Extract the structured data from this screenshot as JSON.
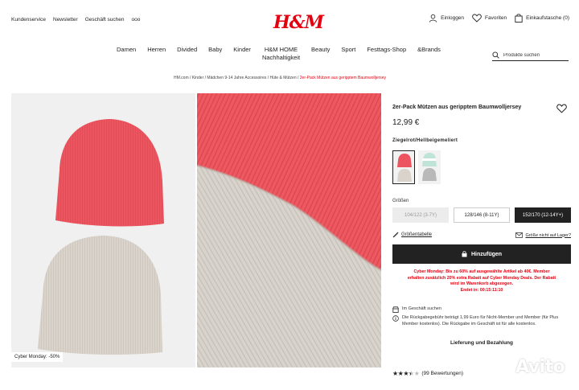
{
  "header": {
    "util_links": [
      "Kundenservice",
      "Newsletter",
      "Geschäft suchen",
      "ooo"
    ],
    "logo": "H&M",
    "account": {
      "login": "Einloggen",
      "favorites": "Favoriten",
      "cart": "Einkaufstasche (0)"
    }
  },
  "nav": {
    "items": [
      "Damen",
      "Herren",
      "Divided",
      "Baby",
      "Kinder"
    ],
    "home_line1": "H&M HOME",
    "home_line2": "Nachhaltigkeit",
    "items_after": [
      "Beauty",
      "Sport",
      "Festtags-Shop",
      "&Brands"
    ],
    "search_placeholder": "Produkte suchen"
  },
  "breadcrumb": {
    "items": [
      "HM.com",
      "Kinder",
      "Mädchen 9-14 Jahre Accessoires",
      "Hüte & Mützen"
    ],
    "current": "2er-Pack Mützen aus geripptem Baumwolljersey"
  },
  "gallery": {
    "promo_badge": "Cyber Monday: -50%"
  },
  "product": {
    "title": "2er-Pack Mützen aus geripptem Baumwolljersey",
    "price": "12,99 €",
    "color_name": "Ziegelrot/Hellbeigemeliert",
    "sizes_label": "Größen",
    "sizes": [
      {
        "label": "104/122 (3-7Y)",
        "state": "unavailable"
      },
      {
        "label": "128/146 (8-11Y)",
        "state": "available"
      },
      {
        "label": "152/170 (12-14Y+)",
        "state": "selected"
      }
    ],
    "size_guide": "Größentabelle",
    "not_fit": "Größe nicht auf Lager?",
    "add_to_cart": "Hinzufügen",
    "promo_lines": [
      "Cyber Monday: Bis zu 60% auf ausgewählte Artikel ab 40€. Member",
      "erhalten zusätzlich 20% extra Rabatt auf Cyber Monday Deals. Der Rabatt",
      "wird im Warenkorb abgezogen.",
      "Endet in: 00:15:11:10"
    ],
    "store_search": "Im Geschäft suchen",
    "return_info": "Die Rückgabegebühr beträgt 1,99 Euro für Nicht-Member und Member (für Plus Member kostenlos). Die Rückgabe im Geschäft ist für alle kostenlos.",
    "delivery": "Lieferung und Bezahlung",
    "rating_stars": 3.5,
    "rating_count": "(99 Bewertungen)"
  },
  "watermark": "Avito",
  "colors": {
    "brand_red": "#e50010",
    "beanie_red": "#ec5560",
    "beanie_beige": "#d9d3cb",
    "dark": "#222222"
  }
}
